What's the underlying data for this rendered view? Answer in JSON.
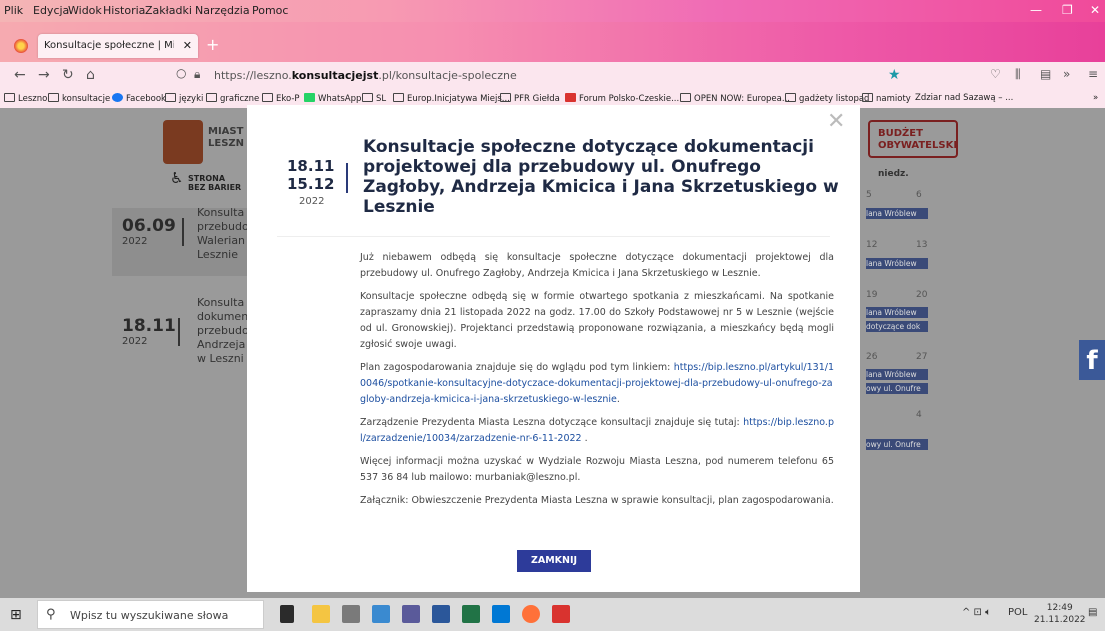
{
  "menu": [
    "Plik",
    "Edycja",
    "Widok",
    "Historia",
    "Zakładki",
    "Narzędzia",
    "Pomoc"
  ],
  "tab": {
    "title": "Konsultacje społeczne | Miasto Leszno",
    "close": "✕",
    "new": "+"
  },
  "nav": {
    "url_prefix": "https://leszno.",
    "url_host": "konsultacjejst",
    "url_suffix": ".pl/konsultacje-spoleczne"
  },
  "bookmarks": [
    "Leszno",
    "konsultacje",
    "Facebook",
    "języki",
    "graficzne",
    "Eko-P",
    "WhatsApp",
    "SL",
    "Europ.Inicjatywa Miejs...",
    "PFR Giełda",
    "Forum Polsko-Czeskie...",
    "OPEN NOW: Europea...",
    "gadżety listopad",
    "namioty",
    "Zdziar nad Sazawą – ..."
  ],
  "site": {
    "logo_line1": "MIAST",
    "logo_line2": "LESZN",
    "budzet_line1": "BUDŻET",
    "budzet_line2": "OBYWATELSKI",
    "bariery_line1": "STRONA",
    "bariery_line2": "BEZ BARIER"
  },
  "calendar": [
    {
      "date": "06.09",
      "year": "2022",
      "lines": [
        "Konsulta",
        "przebudo",
        "Walerian",
        "Lesznie"
      ]
    },
    {
      "date": "18.11",
      "year": "2022",
      "lines": [
        "Konsulta",
        "dokumen",
        "przebudo",
        "Andrzeja",
        "w Leszni"
      ]
    }
  ],
  "right_cal": {
    "header": "niedz.",
    "nums": [
      "5",
      "6",
      "12",
      "13",
      "19",
      "20",
      "26",
      "27",
      "4"
    ],
    "events": [
      "lana Wróblew",
      "lana Wróblew",
      "lana Wróblew",
      "dotyczące dok",
      "lana Wróblew",
      "owy ul. Onufre",
      "owy ul. Onufre"
    ]
  },
  "fb": "f",
  "modal": {
    "close": "✕",
    "date1": "18.11",
    "date2": "15.12",
    "year": "2022",
    "title": "Konsultacje społeczne dotyczące dokumentacji projektowej dla przebudowy ul. Onufrego Zagłoby, Andrzeja Kmicica i Jana Skrzetuskiego w Lesznie",
    "p1": "Już niebawem odbędą się konsultacje społeczne dotyczące dokumentacji projektowej dla przebudowy ul. Onufrego Zagłoby, Andrzeja Kmicica i Jana Skrzetuskiego w Lesznie.",
    "p2": "Konsultacje społeczne odbędą się w formie otwartego spotkania z mieszkańcami. Na spotkanie zapraszamy dnia 21 listopada 2022 na godz. 17.00 do Szkoły Podstawowej nr 5 w Lesznie (wejście od ul. Gronowskiej). Projektanci przedstawią proponowane rozwiązania, a mieszkańcy będą mogli zgłosić swoje uwagi.",
    "p3_text": "Plan zagospodarowania znajduje się do wglądu pod tym linkiem: ",
    "p3_link": "https://bip.leszno.pl/artykul/131/10046/spotkanie-konsultacyjne-dotyczace-dokumentacji-projektowej-dla-przebudowy-ul-onufrego-zagloby-andrzeja-kmicica-i-jana-skrzetuskiego-w-lesznie",
    "p3_end": ".",
    "p4_text": "Zarządzenie Prezydenta Miasta Leszna dotyczące konsultacji znajduje się tutaj: ",
    "p4_link": "https://bip.leszno.pl/zarzadzenie/10034/zarzadzenie-nr-6-11-2022",
    "p4_end": " .",
    "p5": "Więcej informacji można uzyskać w Wydziale Rozwoju Miasta Leszna, pod numerem telefonu 65 537 36 84 lub mailowo: murbaniak@leszno.pl.",
    "p6": "Załącznik: Obwieszczenie Prezydenta Miasta Leszna w sprawie konsultacji, plan zagospodarowania.",
    "button": "ZAMKNIJ"
  },
  "taskbar": {
    "search_placeholder": "Wpisz tu wyszukiwane słowa",
    "lang": "POL",
    "time": "12:49",
    "date": "21.11.2022"
  }
}
